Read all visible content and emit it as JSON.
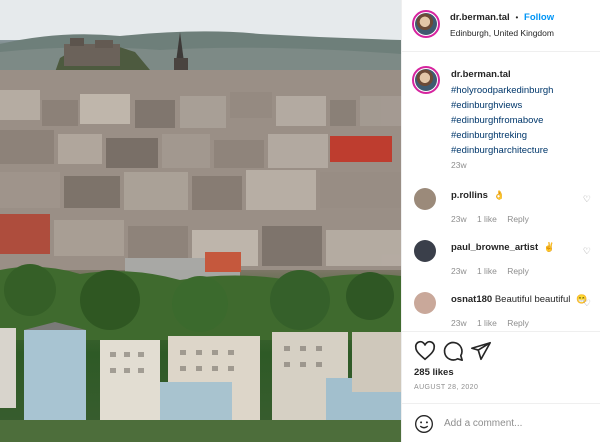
{
  "post": {
    "username": "dr.berman.tal",
    "follow_separator": "•",
    "follow_label": "Follow",
    "location": "Edinburgh, United Kingdom",
    "photo_subject": "Edinburgh cityscape viewed from above with castle and apartment blocks"
  },
  "caption": {
    "username": "dr.berman.tal",
    "hashtags": [
      "#holyroodparkedinburgh",
      "#edinburghviews",
      "#edinburghfromabove",
      "#edinburghtreking",
      "#edinburgharchitecture"
    ],
    "time": "23w"
  },
  "comments": [
    {
      "username": "p.rollins",
      "text": "",
      "emoji": "👌",
      "time": "23w",
      "likes": "1 like",
      "reply": "Reply",
      "avatar_color": "#9b8a7a"
    },
    {
      "username": "paul_browne_artist",
      "text": "",
      "emoji": "✌",
      "time": "23w",
      "likes": "1 like",
      "reply": "Reply",
      "avatar_color": "#3a3f4a"
    },
    {
      "username": "osnat180",
      "text": "Beautiful beautiful",
      "emoji": "😁",
      "time": "23w",
      "likes": "1 like",
      "reply": "Reply",
      "avatar_color": "#c9a89a"
    }
  ],
  "actions": {
    "like_icon": "heart-icon",
    "comment_icon": "comment-icon",
    "share_icon": "share-icon",
    "likes_text": "285 likes",
    "date_text": "AUGUST 28, 2020"
  },
  "add_comment": {
    "placeholder": "Add a comment..."
  },
  "colors": {
    "accent": "#0095f6",
    "hashtag": "#00376b",
    "muted": "#8e8e8e",
    "story_ring": "#d6249f"
  }
}
